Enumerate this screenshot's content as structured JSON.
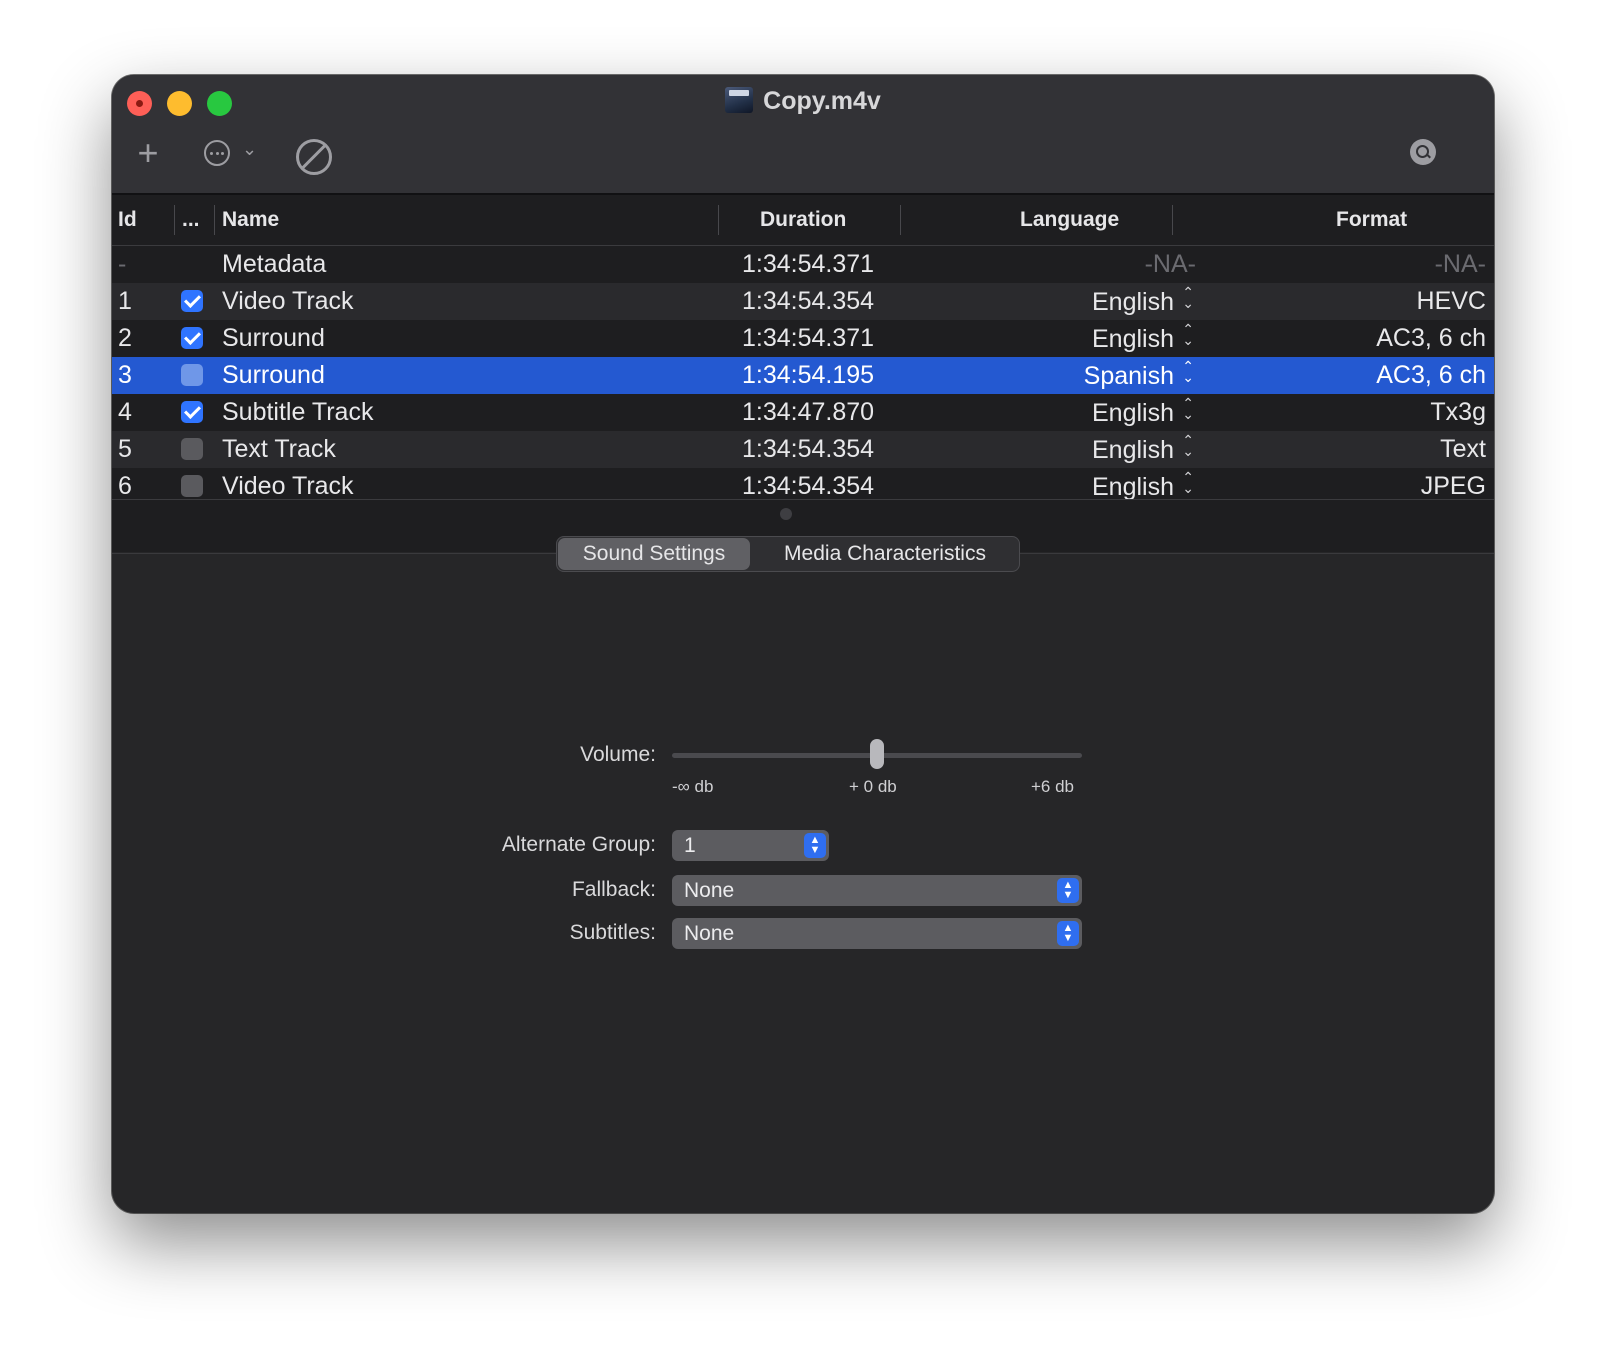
{
  "window": {
    "title": "Copy.m4v",
    "file_icon": "movie-file-icon"
  },
  "toolbar": {
    "add_label": "+",
    "icons": [
      "plus-icon",
      "ellipsis-circle-icon",
      "chevron-down-icon",
      "prohibited-icon",
      "search-icon"
    ]
  },
  "table": {
    "headers": {
      "id": "Id",
      "enabled": "...",
      "name": "Name",
      "duration": "Duration",
      "language": "Language",
      "format": "Format"
    },
    "rows": [
      {
        "id": "-",
        "checked": null,
        "name": "Metadata",
        "duration": "1:34:54.371",
        "language": "-NA-",
        "format": "-NA-"
      },
      {
        "id": "1",
        "checked": true,
        "name": "Video Track",
        "duration": "1:34:54.354",
        "language": "English",
        "format": "HEVC"
      },
      {
        "id": "2",
        "checked": true,
        "name": "Surround",
        "duration": "1:34:54.371",
        "language": "English",
        "format": "AC3, 6 ch"
      },
      {
        "id": "3",
        "checked": false,
        "name": "Surround",
        "duration": "1:34:54.195",
        "language": "Spanish",
        "format": "AC3, 6 ch",
        "selected": true
      },
      {
        "id": "4",
        "checked": true,
        "name": "Subtitle Track",
        "duration": "1:34:47.870",
        "language": "English",
        "format": "Tx3g"
      },
      {
        "id": "5",
        "checked": false,
        "name": "Text Track",
        "duration": "1:34:54.354",
        "language": "English",
        "format": "Text"
      },
      {
        "id": "6",
        "checked": false,
        "name": "Video Track",
        "duration": "1:34:54.354",
        "language": "English",
        "format": "JPEG"
      }
    ]
  },
  "tabs": {
    "active": "Sound Settings",
    "other": "Media Characteristics"
  },
  "sound": {
    "volume_label": "Volume:",
    "volume_fraction": 0.5,
    "ticks": {
      "min": "-∞ db",
      "mid": "+ 0 db",
      "max": "+6 db"
    },
    "alt_group_label": "Alternate Group:",
    "alt_group_value": "1",
    "fallback_label": "Fallback:",
    "fallback_value": "None",
    "subtitles_label": "Subtitles:",
    "subtitles_value": "None"
  },
  "colors": {
    "selection": "#2459d1",
    "checkbox_on": "#2f74ff",
    "popup_arrows": "#2f6ef0"
  }
}
